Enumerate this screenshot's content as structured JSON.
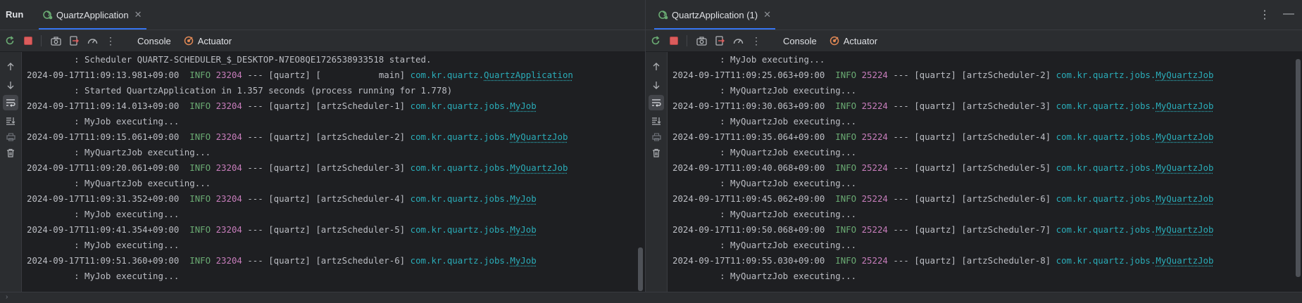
{
  "left": {
    "run_label": "Run",
    "tab_label": "QuartzApplication",
    "toolbar": {
      "console_label": "Console",
      "actuator_label": "Actuator"
    },
    "lines": [
      {
        "kind": "cont",
        "text": "         : Scheduler QUARTZ-SCHEDULER_$_DESKTOP-N7EO8QE1726538933518 started."
      },
      {
        "kind": "log",
        "ts": "2024-09-17T11:09:13.981+09:00",
        "level": "INFO",
        "pid": "23204",
        "mid": " --- [quartz] [           main] ",
        "pkg": "com.kr.quartz.",
        "cls": "QuartzApplication"
      },
      {
        "kind": "cont",
        "text": "         : Started QuartzApplication in 1.357 seconds (process running for 1.778)"
      },
      {
        "kind": "log",
        "ts": "2024-09-17T11:09:14.013+09:00",
        "level": "INFO",
        "pid": "23204",
        "mid": " --- [quartz] [artzScheduler-1] ",
        "pkg": "com.kr.quartz.jobs.",
        "cls": "MyJob"
      },
      {
        "kind": "cont",
        "text": "         : MyJob executing..."
      },
      {
        "kind": "log",
        "ts": "2024-09-17T11:09:15.061+09:00",
        "level": "INFO",
        "pid": "23204",
        "mid": " --- [quartz] [artzScheduler-2] ",
        "pkg": "com.kr.quartz.jobs.",
        "cls": "MyQuartzJob"
      },
      {
        "kind": "cont",
        "text": "         : MyQuartzJob executing..."
      },
      {
        "kind": "log",
        "ts": "2024-09-17T11:09:20.061+09:00",
        "level": "INFO",
        "pid": "23204",
        "mid": " --- [quartz] [artzScheduler-3] ",
        "pkg": "com.kr.quartz.jobs.",
        "cls": "MyQuartzJob"
      },
      {
        "kind": "cont",
        "text": "         : MyQuartzJob executing..."
      },
      {
        "kind": "log",
        "ts": "2024-09-17T11:09:31.352+09:00",
        "level": "INFO",
        "pid": "23204",
        "mid": " --- [quartz] [artzScheduler-4] ",
        "pkg": "com.kr.quartz.jobs.",
        "cls": "MyJob"
      },
      {
        "kind": "cont",
        "text": "         : MyJob executing..."
      },
      {
        "kind": "log",
        "ts": "2024-09-17T11:09:41.354+09:00",
        "level": "INFO",
        "pid": "23204",
        "mid": " --- [quartz] [artzScheduler-5] ",
        "pkg": "com.kr.quartz.jobs.",
        "cls": "MyJob"
      },
      {
        "kind": "cont",
        "text": "         : MyJob executing..."
      },
      {
        "kind": "log",
        "ts": "2024-09-17T11:09:51.360+09:00",
        "level": "INFO",
        "pid": "23204",
        "mid": " --- [quartz] [artzScheduler-6] ",
        "pkg": "com.kr.quartz.jobs.",
        "cls": "MyJob"
      },
      {
        "kind": "cont",
        "text": "         : MyJob executing..."
      }
    ]
  },
  "right": {
    "tab_label": "QuartzApplication (1)",
    "toolbar": {
      "console_label": "Console",
      "actuator_label": "Actuator"
    },
    "lines": [
      {
        "kind": "cont",
        "text": "         : MyJob executing..."
      },
      {
        "kind": "log",
        "ts": "2024-09-17T11:09:25.063+09:00",
        "level": "INFO",
        "pid": "25224",
        "mid": " --- [quartz] [artzScheduler-2] ",
        "pkg": "com.kr.quartz.jobs.",
        "cls": "MyQuartzJob"
      },
      {
        "kind": "cont",
        "text": "         : MyQuartzJob executing..."
      },
      {
        "kind": "log",
        "ts": "2024-09-17T11:09:30.063+09:00",
        "level": "INFO",
        "pid": "25224",
        "mid": " --- [quartz] [artzScheduler-3] ",
        "pkg": "com.kr.quartz.jobs.",
        "cls": "MyQuartzJob"
      },
      {
        "kind": "cont",
        "text": "         : MyQuartzJob executing..."
      },
      {
        "kind": "log",
        "ts": "2024-09-17T11:09:35.064+09:00",
        "level": "INFO",
        "pid": "25224",
        "mid": " --- [quartz] [artzScheduler-4] ",
        "pkg": "com.kr.quartz.jobs.",
        "cls": "MyQuartzJob"
      },
      {
        "kind": "cont",
        "text": "         : MyQuartzJob executing..."
      },
      {
        "kind": "log",
        "ts": "2024-09-17T11:09:40.068+09:00",
        "level": "INFO",
        "pid": "25224",
        "mid": " --- [quartz] [artzScheduler-5] ",
        "pkg": "com.kr.quartz.jobs.",
        "cls": "MyQuartzJob"
      },
      {
        "kind": "cont",
        "text": "         : MyQuartzJob executing..."
      },
      {
        "kind": "log",
        "ts": "2024-09-17T11:09:45.062+09:00",
        "level": "INFO",
        "pid": "25224",
        "mid": " --- [quartz] [artzScheduler-6] ",
        "pkg": "com.kr.quartz.jobs.",
        "cls": "MyQuartzJob"
      },
      {
        "kind": "cont",
        "text": "         : MyQuartzJob executing..."
      },
      {
        "kind": "log",
        "ts": "2024-09-17T11:09:50.068+09:00",
        "level": "INFO",
        "pid": "25224",
        "mid": " --- [quartz] [artzScheduler-7] ",
        "pkg": "com.kr.quartz.jobs.",
        "cls": "MyQuartzJob"
      },
      {
        "kind": "cont",
        "text": "         : MyQuartzJob executing..."
      },
      {
        "kind": "log",
        "ts": "2024-09-17T11:09:55.030+09:00",
        "level": "INFO",
        "pid": "25224",
        "mid": " --- [quartz] [artzScheduler-8] ",
        "pkg": "com.kr.quartz.jobs.",
        "cls": "MyQuartzJob"
      },
      {
        "kind": "cont",
        "text": "         : MyQuartzJob executing..."
      }
    ]
  },
  "icons": {
    "tab_icon": "spring-run-icon",
    "rerun": "rerun-icon",
    "stop": "stop-icon",
    "screenshot": "camera-icon",
    "exit": "exit-icon",
    "dashboard": "dashboard-icon",
    "more": "more-icon",
    "actuator": "actuator-icon"
  },
  "colors": {
    "background": "#1e1f22",
    "panel": "#2b2d30",
    "accent": "#3574f0",
    "info": "#6aab73",
    "pid": "#c77dbb",
    "logger": "#2aacb8",
    "stop": "#db5c5c"
  }
}
